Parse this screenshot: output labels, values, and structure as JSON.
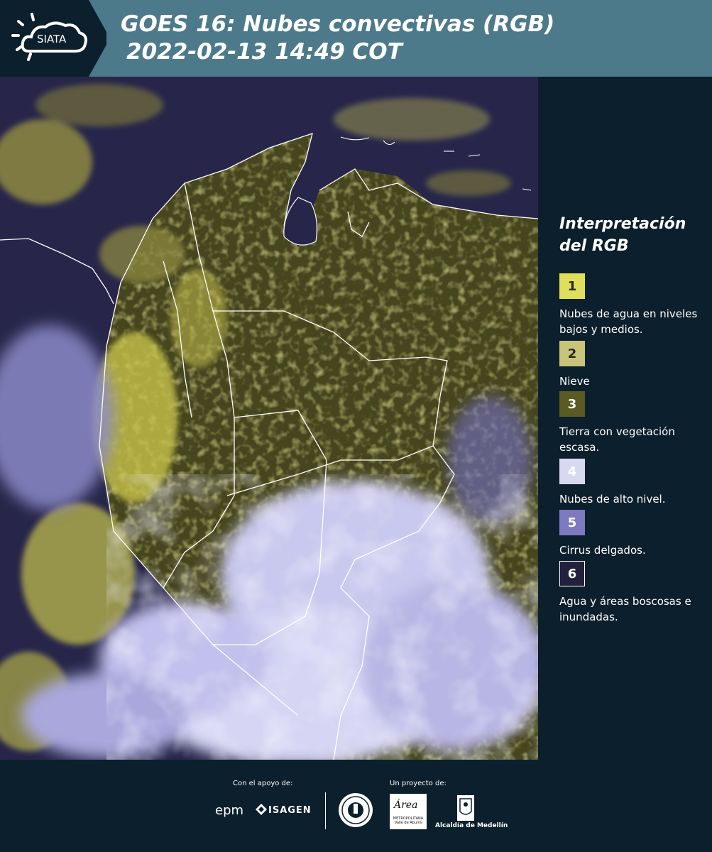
{
  "header": {
    "logo_text": "SIATA",
    "title_line1": "GOES 16: Nubes convectivas (RGB)",
    "title_line2": "2022-02-13 14:49 COT"
  },
  "legend": {
    "title": "Interpretación del RGB",
    "items": [
      {
        "number": "1",
        "label": "Nubes de agua en niveles bajos y medios.",
        "color": "#e0df5c",
        "text_color": "#2a2a10"
      },
      {
        "number": "2",
        "label": "Nieve",
        "color": "#c8c47a",
        "text_color": "#2a2a10"
      },
      {
        "number": "3",
        "label": "Tierra con vegetación escasa.",
        "color": "#5a5a22",
        "text_color": "#ffffff"
      },
      {
        "number": "4",
        "label": "Nubes de alto nivel.",
        "color": "#d8d8f2",
        "text_color": "#ffffff"
      },
      {
        "number": "5",
        "label": "Cirrus delgados.",
        "color": "#7d7ac0",
        "text_color": "#ffffff"
      },
      {
        "number": "6",
        "label": "Agua y áreas boscosas e inundadas.",
        "color": "#22203c",
        "text_color": "#ffffff"
      }
    ]
  },
  "footer": {
    "support_label": "Con el apoyo de:",
    "project_label": "Un proyecto de:",
    "epm_logo": "epm",
    "isagen_logo": "ISAGEN",
    "area_logo": "Área",
    "area_sub": "METROPOLITANA Valle de Aburrá",
    "alcaldia_logo": "Alcaldía de Medellín"
  },
  "colors": {
    "header_bg": "#4d7a8a",
    "panel_bg": "#0c1f2c",
    "low_cloud_yellow": "#d9d35a",
    "high_cloud_lavender": "#d8d8f2",
    "vegetation": "#4a4a20",
    "water": "#27264a"
  }
}
